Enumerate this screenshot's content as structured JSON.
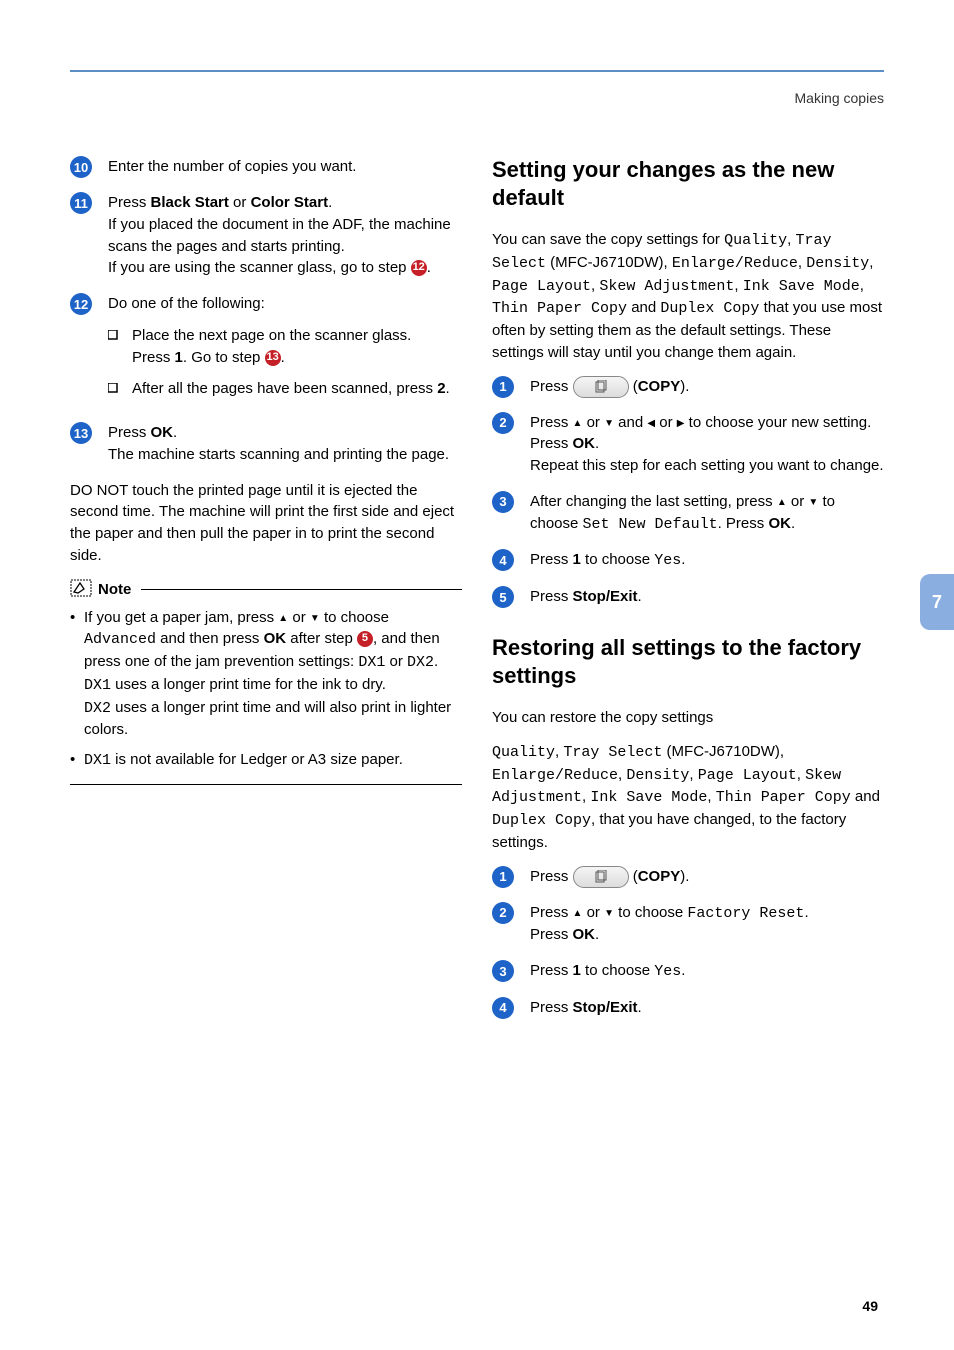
{
  "header": {
    "title": "Making copies"
  },
  "side_tab": "7",
  "page_number": "49",
  "left": {
    "step10": {
      "num": "10",
      "text": "Enter the number of copies you want."
    },
    "step11": {
      "num": "11",
      "l1a": "Press ",
      "l1b": "Black Start",
      "l1c": " or ",
      "l1d": "Color Start",
      "l1e": ".",
      "l2": "If you placed the document in the ADF, the machine scans the pages and starts printing.",
      "l3a": "If you are using the scanner glass, go to step ",
      "l3b": ".",
      "ref12": "12"
    },
    "step12": {
      "num": "12",
      "head": "Do one of the following:",
      "b1a": "Place the next page on the scanner glass.",
      "b1b_a": "Press ",
      "b1b_b": "1",
      "b1b_c": ". Go to step ",
      "b1b_d": ".",
      "ref13": "13",
      "b2a": "After all the pages have been scanned, press ",
      "b2b": "2",
      "b2c": "."
    },
    "step13": {
      "num": "13",
      "l1a": "Press ",
      "l1b": "OK",
      "l1c": ".",
      "l2": "The machine starts scanning and printing the page."
    },
    "warn": "DO NOT touch the printed page until it is ejected the second time. The machine will print the first side and eject the paper and then pull the paper in to print the second side.",
    "note_title": "Note",
    "note1_a": "If you get a paper jam, press ",
    "note1_b": " or ",
    "note1_c": " to choose ",
    "note1_adv": "Advanced",
    "note1_d": " and then press ",
    "note1_ok": "OK",
    "note1_e": " after step ",
    "note1_ref": "5",
    "note1_f": ", and then press one of the jam prevention settings: ",
    "note1_dx1": "DX1",
    "note1_g": " or ",
    "note1_dx2": "DX2",
    "note1_h": ".",
    "note1_i": " uses a longer print time for the ink to dry.",
    "note1_j": " uses a longer print time and will also print in lighter colors.",
    "note2_a": " is not available for Ledger or A3 size paper."
  },
  "right": {
    "h1": "Setting your changes as the new default",
    "p1_a": "You can save the copy settings for ",
    "p1_q": "Quality",
    "p1_b": ", ",
    "p1_ts": "Tray Select",
    "p1_c": " (MFC-J6710DW), ",
    "p1_er": "Enlarge/Reduce",
    "p1_d": ", ",
    "p1_den": "Density",
    "p1_e": ", ",
    "p1_pl": "Page Layout",
    "p1_f": ", ",
    "p1_sa": "Skew Adjustment",
    "p1_g": ", ",
    "p1_ism": "Ink Save Mode",
    "p1_h": ", ",
    "p1_tpc": "Thin Paper Copy",
    "p1_i": " and ",
    "p1_dc": "Duplex Copy",
    "p1_j": " that you use most often by setting them as the default settings. These settings will stay until you change them again.",
    "s1": {
      "num": "1",
      "a": "Press ",
      "b": " (",
      "c": "COPY",
      "d": ")."
    },
    "s2": {
      "num": "2",
      "a": "Press ",
      "b": " or ",
      "c": " and ",
      "d": " or ",
      "e": " to choose your new setting.",
      "f": "Press ",
      "ok": "OK",
      "g": ".",
      "h": "Repeat this step for each setting you want to change."
    },
    "s3": {
      "num": "3",
      "a": "After changing the last setting, press ",
      "b": " or ",
      "c": " to choose ",
      "snd": "Set New Default",
      "d": ". Press ",
      "ok": "OK",
      "e": "."
    },
    "s4": {
      "num": "4",
      "a": "Press ",
      "one": "1",
      "b": " to choose ",
      "yes": "Yes",
      "c": "."
    },
    "s5": {
      "num": "5",
      "a": "Press ",
      "se": "Stop/Exit",
      "b": "."
    },
    "h2": "Restoring all settings to the factory settings",
    "p2": "You can restore the copy settings",
    "p3_a": "",
    "p3_q": "Quality",
    "p3_b": ", ",
    "p3_ts": "Tray Select",
    "p3_c": " (MFC-J6710DW), ",
    "p3_er": "Enlarge/Reduce",
    "p3_d": ", ",
    "p3_den": "Density",
    "p3_e": ", ",
    "p3_pl": "Page Layout",
    "p3_f": ", ",
    "p3_sa": "Skew Adjustment",
    "p3_g": ", ",
    "p3_ism": "Ink Save Mode",
    "p3_h": ", ",
    "p3_tpc": "Thin Paper Copy",
    "p3_i": " and ",
    "p3_dc": "Duplex Copy",
    "p3_j": ", that you have changed, to the factory settings.",
    "r1": {
      "num": "1",
      "a": "Press ",
      "b": " (",
      "c": "COPY",
      "d": ")."
    },
    "r2": {
      "num": "2",
      "a": "Press ",
      "b": " or ",
      "c": " to choose ",
      "fr": "Factory Reset",
      "d": ".",
      "e": "Press ",
      "ok": "OK",
      "f": "."
    },
    "r3": {
      "num": "3",
      "a": "Press ",
      "one": "1",
      "b": " to choose ",
      "yes": "Yes",
      "c": "."
    },
    "r4": {
      "num": "4",
      "a": "Press ",
      "se": "Stop/Exit",
      "b": "."
    }
  }
}
